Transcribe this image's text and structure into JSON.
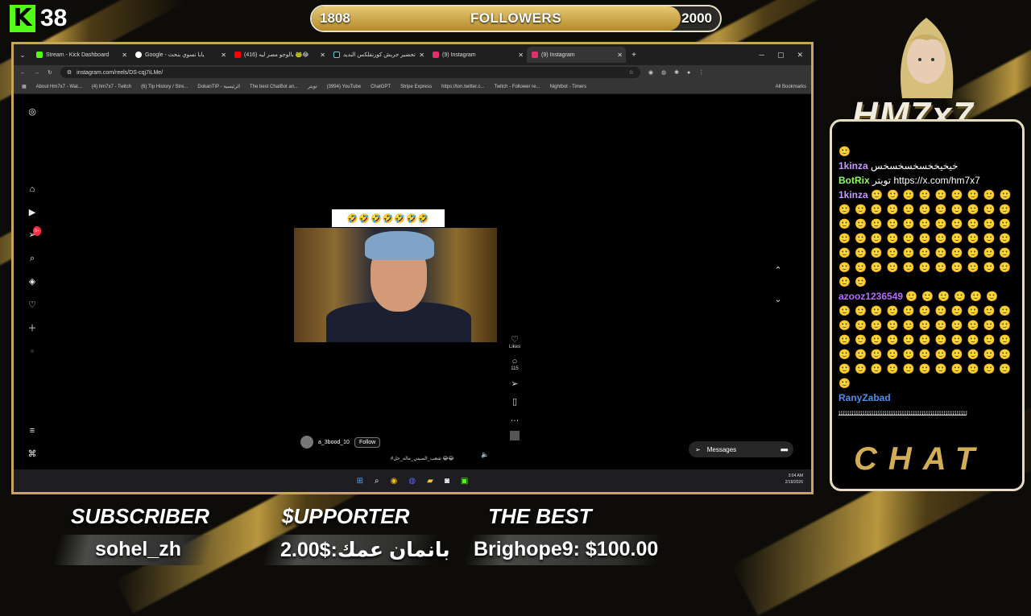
{
  "overlay": {
    "kick_icon": "kick-k-logo",
    "kick_count": "38",
    "followers": {
      "current": "1808",
      "label": "FOLLOWERS",
      "goal": "2000",
      "progress": 0.904
    },
    "streamer_logo": "HM7x7",
    "chat_title": "CHAT"
  },
  "browser": {
    "tabs": [
      {
        "label": "Stream - Kick Dashboard",
        "color": "#53fc18"
      },
      {
        "label": "Google - يابا نسوي بنحث",
        "color": "#ffffff"
      },
      {
        "label": "(416) بالوجو مصر ليه 🐸😂",
        "color": "#ff0000"
      },
      {
        "label": "تحضير جريش كورنفلكس البديد",
        "color": "#000000"
      },
      {
        "label": "(9) Instagram",
        "color": "#e1306c"
      },
      {
        "label": "(9) Instagram",
        "color": "#e1306c"
      }
    ],
    "new_tab": "+",
    "url": "instagram.com/reels/DS-cqj7iLMe/",
    "bookmarks": [
      "About Hm7x7 - Wat...",
      "(4) hm7x7 - Twitch",
      "(6) Tip History / Stre...",
      "DokanTIP - الرئيسية",
      "The best ChatBot an...",
      "تويتر",
      "(3994) YouTube",
      "ChatGPT",
      "Stripe Express",
      "https://ton.twitter.c...",
      "Twitch - Follower re...",
      "Nightbot - Timers",
      "All Bookmarks"
    ]
  },
  "instagram": {
    "sidebar_icons": [
      "instagram-icon",
      "home-icon",
      "reels-icon",
      "messages-icon",
      "search-icon",
      "explore-icon",
      "notifications-icon",
      "create-icon",
      "profile-icon",
      "menu-icon",
      "apps-icon"
    ],
    "messages_badge": "9+",
    "reel": {
      "emoji_caption": "🤣🤣🤣🤣🤣🤣🤣",
      "username": "a_3bood_10",
      "follow_label": "Follow",
      "caption": "#شعب_الصيني_ماله_حل 😂😂",
      "likes_label": "Likes",
      "comments_count": "115"
    },
    "messages_label": "Messages"
  },
  "taskbar": {
    "time": "3:04 AM",
    "date": "2/18/2026"
  },
  "chat": {
    "messages": [
      {
        "user": "",
        "text": "🙂",
        "color": "#ffffff"
      },
      {
        "user": "1kinza",
        "text": "خيخيخخسخسخسخس",
        "color": "#c79bff"
      },
      {
        "user": "BotRix",
        "text": "تويتر https://x.com/hm7x7",
        "color": "#8cff5a"
      },
      {
        "user": "1kinza",
        "text": "🙂🙂🙂🙂🙂🙂🙂🙂🙂🙂🙂🙂🙂🙂🙂🙂🙂🙂🙂🙂🙂🙂🙂🙂🙂🙂🙂🙂🙂🙂🙂🙂🙂🙂🙂🙂🙂🙂🙂🙂🙂🙂🙂🙂🙂🙂🙂🙂🙂🙂🙂🙂🙂🙂🙂🙂🙂🙂🙂🙂🙂🙂🙂🙂🙂🙂",
        "color": "#c79bff"
      },
      {
        "user": "azooz1236549",
        "text": "🙂🙂🙂🙂🙂🙂🙂🙂🙂🙂🙂🙂🙂🙂🙂🙂🙂🙂🙂🙂🙂🙂🙂🙂🙂🙂🙂🙂🙂🙂🙂🙂🙂🙂🙂🙂🙂🙂🙂🙂🙂🙂🙂🙂🙂🙂🙂🙂🙂🙂🙂🙂🙂🙂🙂🙂🙂🙂🙂🙂🙂🙂",
        "color": "#b76bff"
      },
      {
        "user": "RanyZabad",
        "text": "ﺋﺌﺌﺌﺌﺌﺌﺌﺌﺌﺌﺌﺌﺌﺌﺌﺌﺌﺌﺌﺌﺌﺌﺌﺌﺌﺌﺌﺌﺌﺌﺌﺌﺌﺌﺌﺌﺌﺌﺌﺌﺌﺌﺌﺌﺌﺌﺌﺌﺌﺌﺌﺌﺌﺌﺌﺌﺌﺌ",
        "color": "#4f8fe8"
      }
    ]
  },
  "bottom": {
    "subscriber": {
      "label": "SUBSCRIBER",
      "value": "sohel_zh"
    },
    "supporter": {
      "label": "$UPPORTER",
      "value": "2.00$:بانمان عمك"
    },
    "best": {
      "label": "THE BEST",
      "value": "Brighope9: $100.00"
    }
  },
  "colors": {
    "accent_gold": "#d2ad56",
    "kick_green": "#53fc18",
    "frame": "#e7dcc0"
  }
}
